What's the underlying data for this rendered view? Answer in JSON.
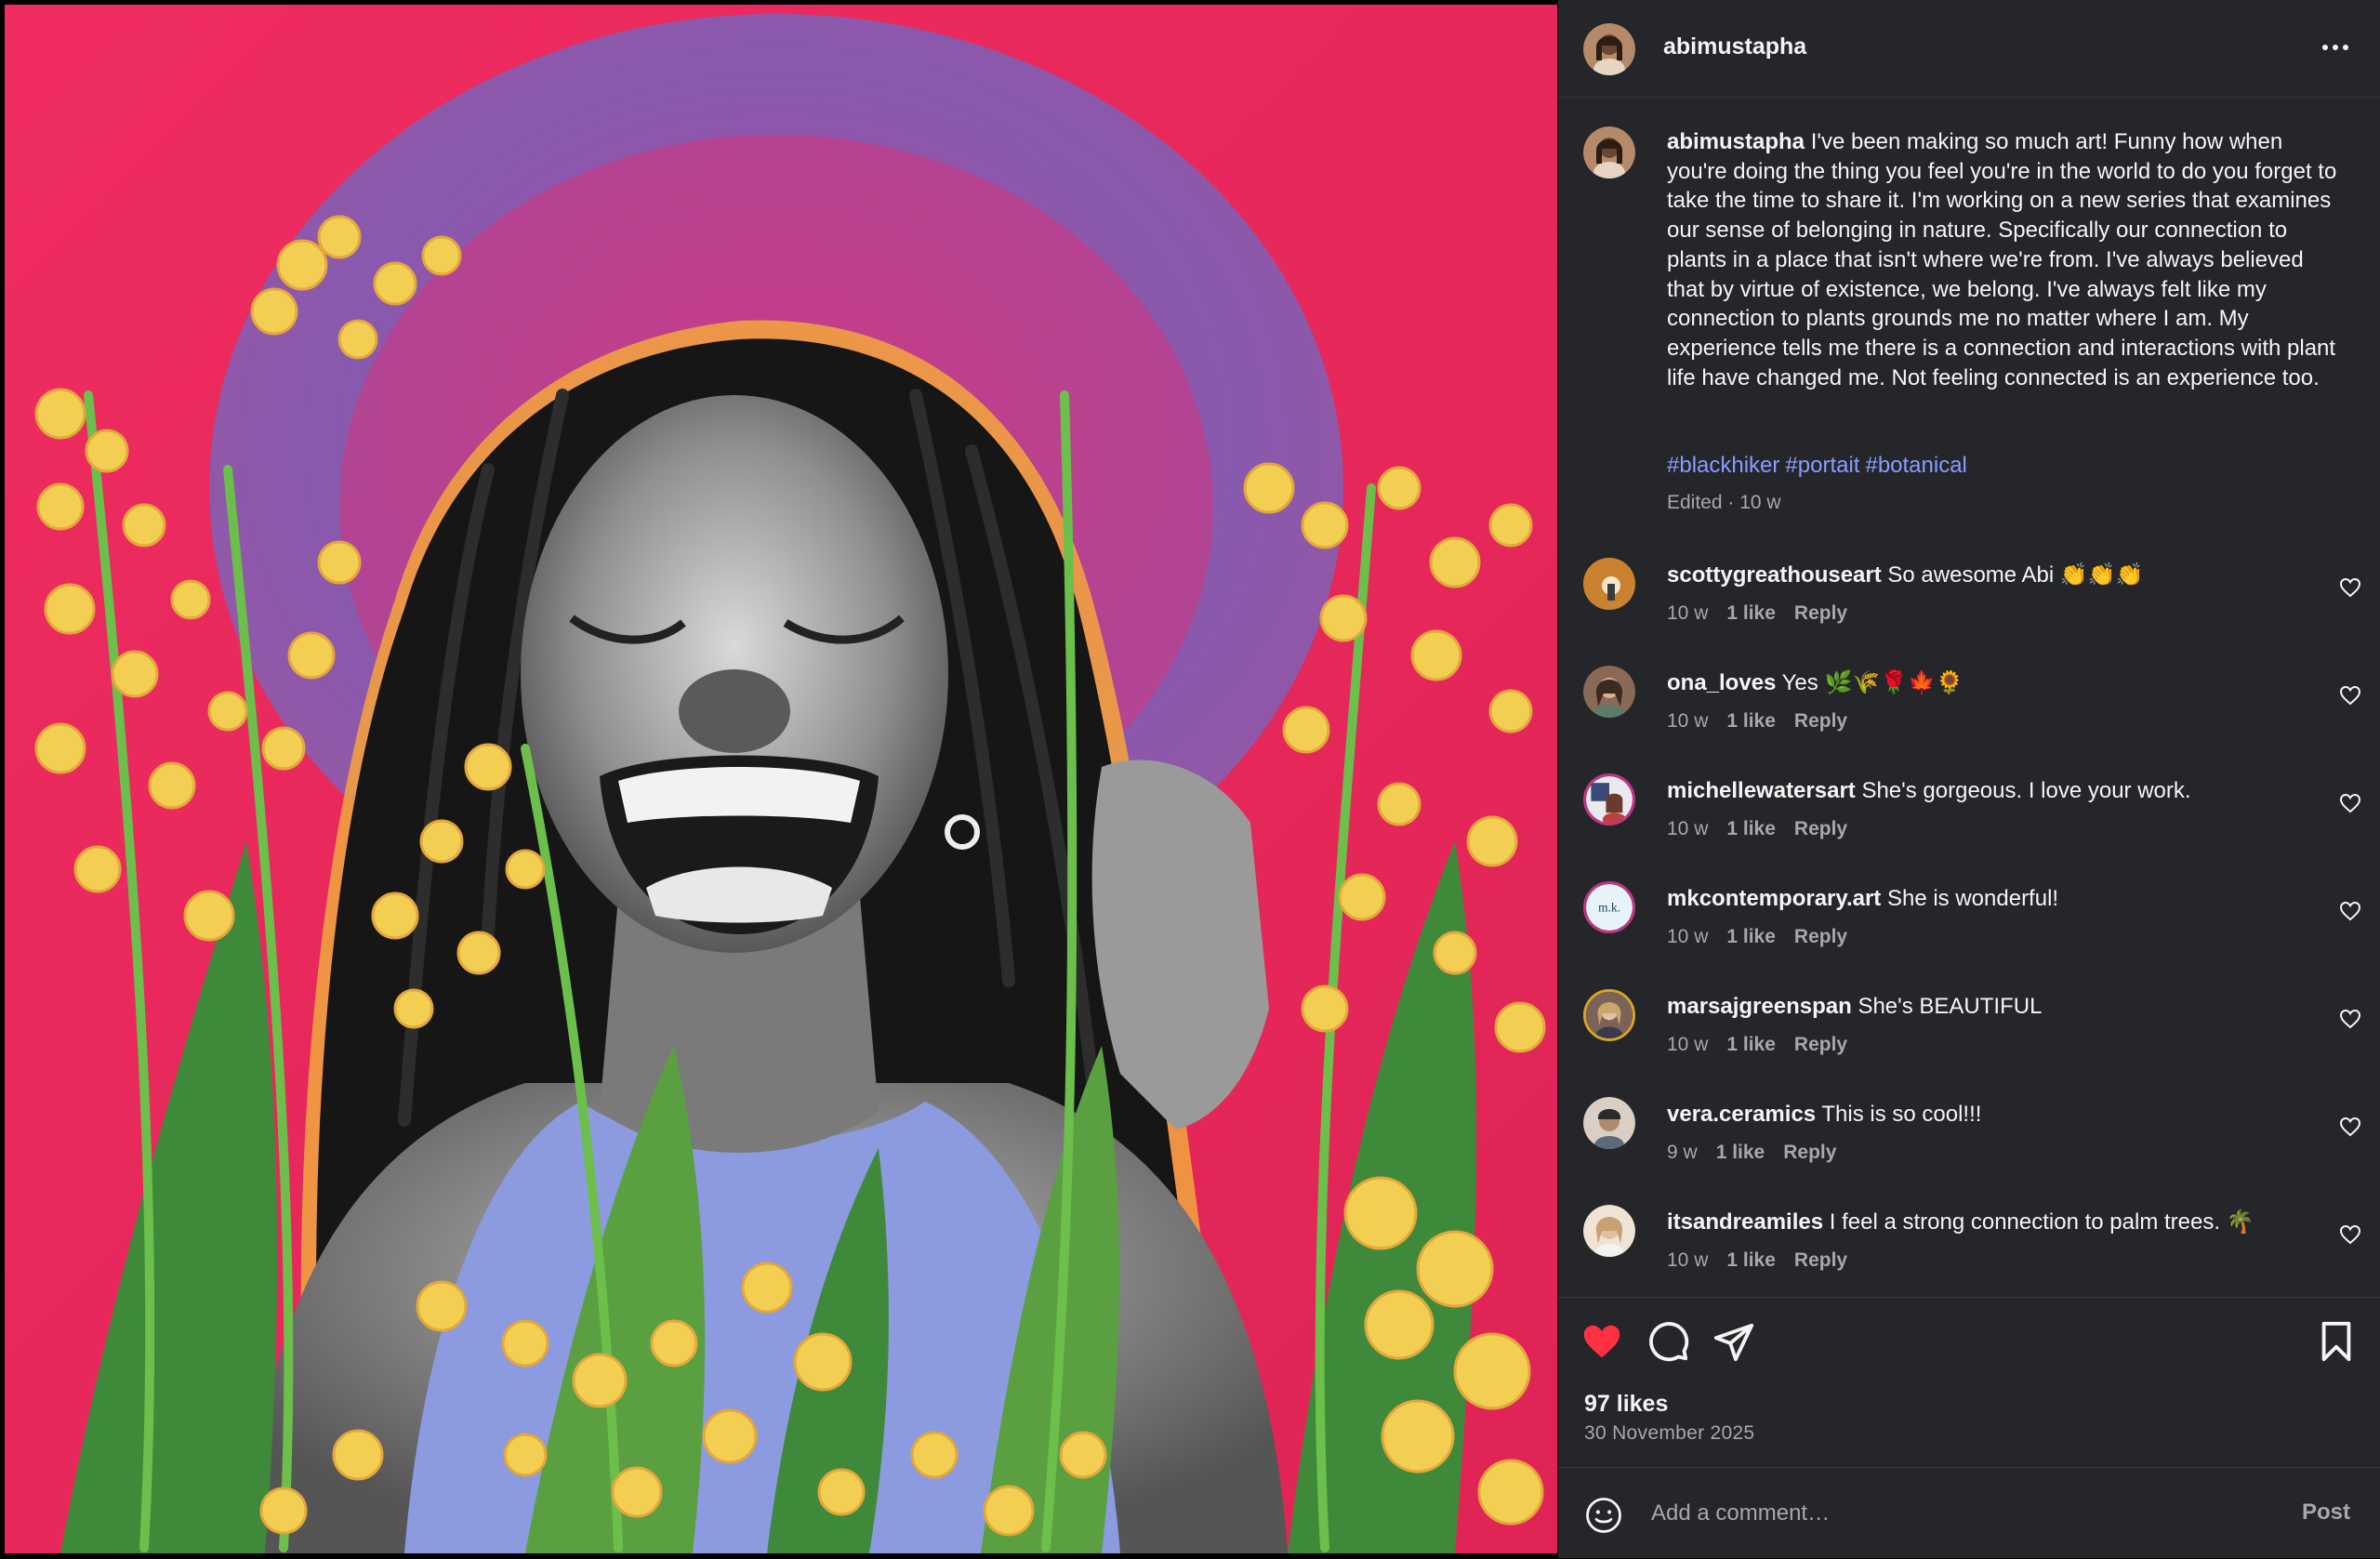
{
  "post": {
    "username": "abimustapha",
    "caption": "I've been making so much art! Funny how when you're doing the thing you feel you're in the world to do you forget to take the time to share it. I'm working on a new series that examines our sense of belonging in nature. Specifically our connection to plants in a place that isn't where we're from. I've always believed that by virtue of existence, we belong. I've always felt like my connection to plants grounds me no matter where I am. My experience tells me there is a connection and interactions with plant life have changed me. Not feeling connected is an experience too.",
    "hashtags": [
      "#blackhiker",
      "#portait",
      "#botanical"
    ],
    "edited": "Edited · 10 w",
    "likes": "97 likes",
    "date": "30 November 2025",
    "liked": true
  },
  "comments": [
    {
      "username": "scottygreathouseart",
      "text": "So awesome Abi 👏👏👏",
      "time": "10 w",
      "likes": "1 like",
      "reply": "Reply",
      "avatar_color": "#c9822f"
    },
    {
      "username": "ona_loves",
      "text": "Yes 🌿🌾🌹🍁🌻",
      "time": "10 w",
      "likes": "1 like",
      "reply": "Reply",
      "avatar_color": "#8a6a56"
    },
    {
      "username": "michellewatersart",
      "text": "She's gorgeous. I love your work.",
      "time": "10 w",
      "likes": "1 like",
      "reply": "Reply",
      "avatar_color": "#3a4a7a"
    },
    {
      "username": "mkcontemporary.art",
      "text": "She is wonderful!",
      "time": "10 w",
      "likes": "1 like",
      "reply": "Reply",
      "avatar_color": "#e6f3f8",
      "avatar_text": "m.k."
    },
    {
      "username": "marsajgreenspan",
      "text": "She's BEAUTIFUL",
      "time": "10 w",
      "likes": "1 like",
      "reply": "Reply",
      "avatar_color": "#7b6358"
    },
    {
      "username": "vera.ceramics",
      "text": "This is so cool!!!",
      "time": "9 w",
      "likes": "1 like",
      "reply": "Reply",
      "avatar_color": "#b49a86"
    },
    {
      "username": "itsandreamiles",
      "text": "I feel a strong connection to palm trees. 🌴",
      "time": "10 w",
      "likes": "1 like",
      "reply": "Reply",
      "avatar_color": "#c9a98e"
    }
  ],
  "comment_box": {
    "placeholder": "Add a comment…",
    "post_label": "Post"
  },
  "colors": {
    "panel_bg": "#25262a",
    "hashtag": "#8a9cff",
    "heart_liked": "#ff3040",
    "muted": "#a8a8a8"
  },
  "icons": [
    "more-icon",
    "heart-icon",
    "comment-icon",
    "share-icon",
    "bookmark-icon",
    "emoji-icon"
  ]
}
